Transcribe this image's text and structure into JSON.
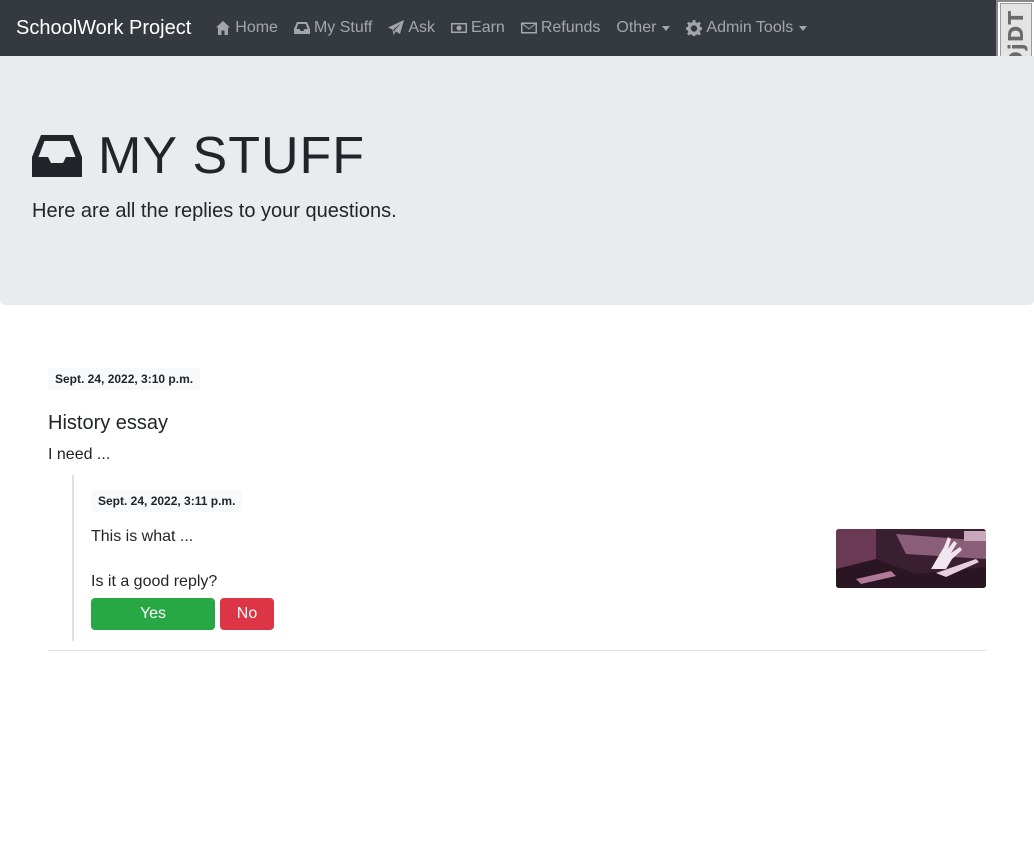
{
  "navbar": {
    "brand": "SchoolWork Project",
    "items": [
      {
        "label": "Home",
        "icon": "home-icon"
      },
      {
        "label": "My Stuff",
        "icon": "inbox-icon"
      },
      {
        "label": "Ask",
        "icon": "paper-plane-icon"
      },
      {
        "label": "Earn",
        "icon": "money-icon"
      },
      {
        "label": "Refunds",
        "icon": "envelope-icon"
      },
      {
        "label": "Other",
        "icon": "caret-down-icon"
      },
      {
        "label": "Admin Tools",
        "icon": "gear-icon"
      }
    ],
    "debug_toolbar_label": "DjDT"
  },
  "header": {
    "title": "MY STUFF",
    "icon": "inbox-icon",
    "subtitle": "Here are all the replies to your questions."
  },
  "question": {
    "timestamp": "Sept. 24, 2022, 3:10 p.m.",
    "title": "History essay",
    "body": "I need ..."
  },
  "reply": {
    "timestamp": "Sept. 24, 2022, 3:11 p.m.",
    "body": "This is what ...",
    "prompt": "Is it a good reply?",
    "yes_label": "Yes",
    "no_label": "No"
  },
  "colors": {
    "navbar": "#343a40",
    "jumbotron": "#e9ecef",
    "yes": "#28a745",
    "no": "#dc3545"
  }
}
